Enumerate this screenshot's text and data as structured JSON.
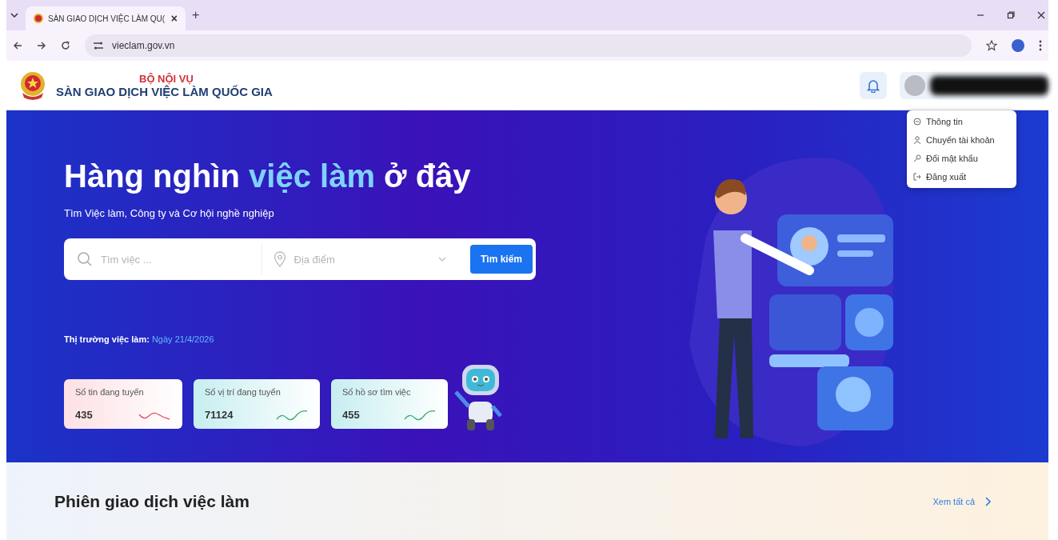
{
  "browser": {
    "tab": {
      "title": "SÀN GIAO DỊCH VIỆC LÀM QU(",
      "close": "×"
    },
    "new_tab": "+",
    "url": "vieclam.gov.vn"
  },
  "header": {
    "ministry": "BỘ NỘI VỤ",
    "site_name": "SÀN GIAO DỊCH VIỆC LÀM QUỐC GIA"
  },
  "user_menu": [
    {
      "label": "Thông tin"
    },
    {
      "label": "Chuyển tài khoản"
    },
    {
      "label": "Đổi mật khẩu"
    },
    {
      "label": "Đăng xuất"
    }
  ],
  "hero": {
    "title_before": "Hàng nghìn ",
    "title_highlight": "việc làm",
    "title_after": " ở đây",
    "subtitle": "Tìm Việc làm, Công ty và Cơ hội nghề nghiệp",
    "search": {
      "placeholder": "Tìm việc ...",
      "location_placeholder": "Địa điểm",
      "button": "Tìm kiếm"
    },
    "market_label": "Thị trường việc làm:",
    "market_date": "Ngày 21/4/2026",
    "stats": [
      {
        "label": "Số tin đang tuyển",
        "value": "435",
        "kind": "down"
      },
      {
        "label": "Số vị trí đang tuyển",
        "value": "71124",
        "kind": "up"
      },
      {
        "label": "Số hồ sơ tìm việc",
        "value": "455",
        "kind": "up"
      }
    ]
  },
  "section": {
    "title": "Phiên giao dịch việc làm",
    "link": "Xem tất cả"
  }
}
